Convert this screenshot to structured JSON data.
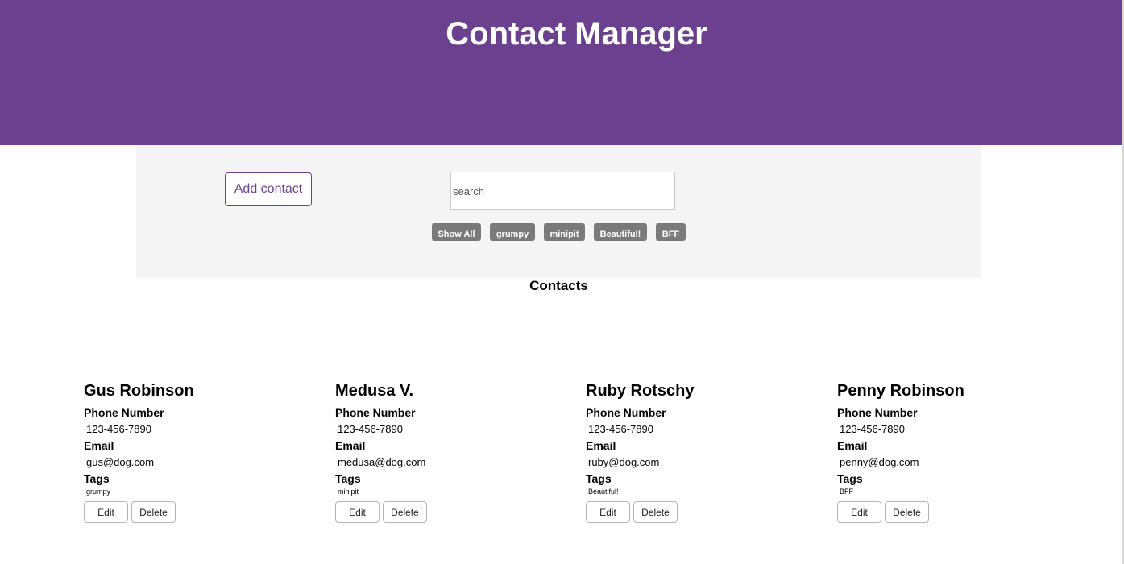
{
  "header": {
    "title": "Contact Manager"
  },
  "toolbar": {
    "add_label": "Add contact",
    "search_placeholder": "search",
    "filters": [
      "Show All",
      "grumpy",
      "minipit",
      "Beautiful!",
      "BFF"
    ]
  },
  "contacts_title": "Contacts",
  "labels": {
    "phone": "Phone Number",
    "email": "Email",
    "tags": "Tags",
    "edit": "Edit",
    "delete": "Delete"
  },
  "contacts": [
    {
      "name": "Gus Robinson",
      "phone": "123-456-7890",
      "email": "gus@dog.com",
      "tag": "grumpy"
    },
    {
      "name": "Medusa V.",
      "phone": "123-456-7890",
      "email": "medusa@dog.com",
      "tag": "minipit"
    },
    {
      "name": "Ruby Rotschy",
      "phone": "123-456-7890",
      "email": "ruby@dog.com",
      "tag": "Beautiful!"
    },
    {
      "name": "Penny Robinson",
      "phone": "123-456-7890",
      "email": "penny@dog.com",
      "tag": "BFF"
    }
  ],
  "colors": {
    "header": "#6b408f",
    "toolbar_bg": "#f4f4f4",
    "filter_bg": "#7a7a7a"
  }
}
